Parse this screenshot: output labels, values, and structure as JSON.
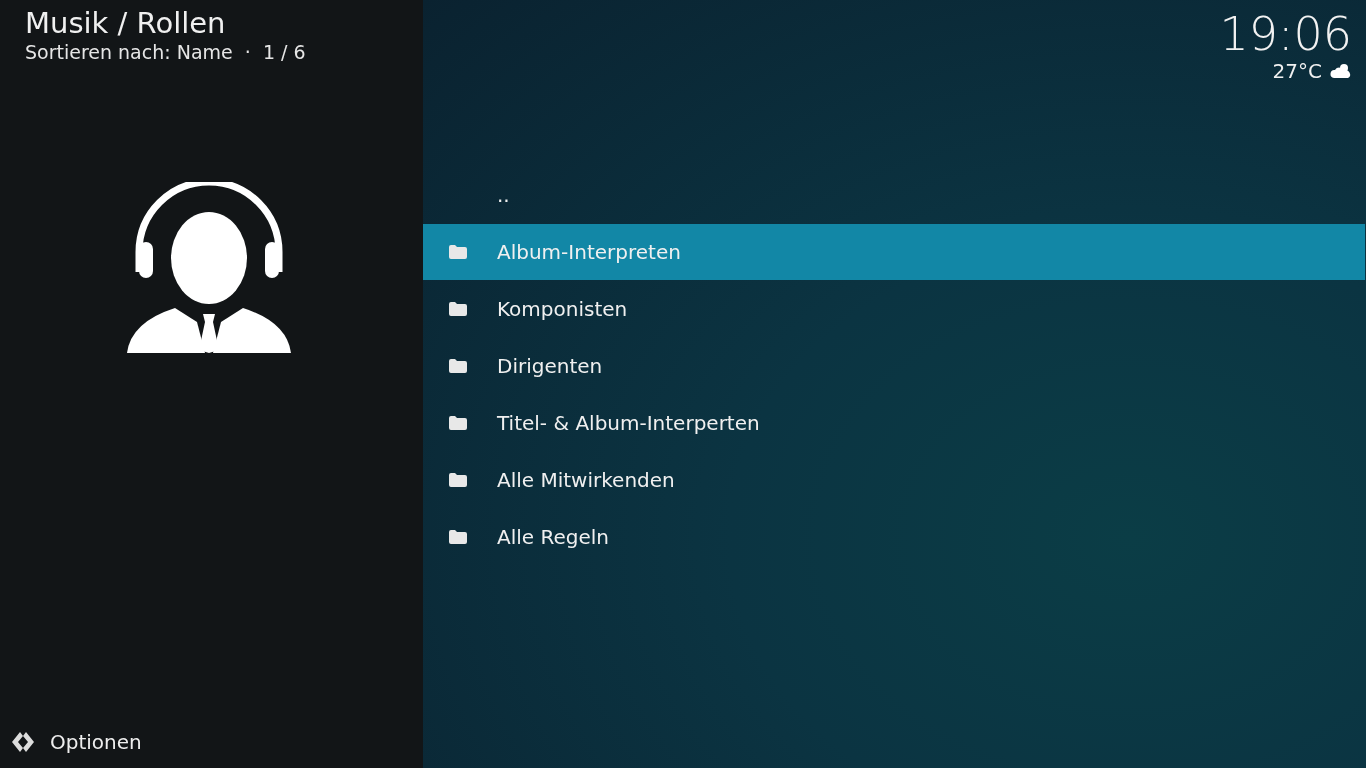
{
  "header": {
    "title": "Musik / Rollen",
    "subtitle": "Sortieren nach: Name  ·  1 / 6"
  },
  "clock": {
    "time": "19:06",
    "temperature": "27°C"
  },
  "list": [
    {
      "kind": "parent",
      "label": "..",
      "selected": false
    },
    {
      "kind": "folder",
      "label": "Album-Interpreten",
      "selected": true
    },
    {
      "kind": "folder",
      "label": "Komponisten",
      "selected": false
    },
    {
      "kind": "folder",
      "label": "Dirigenten",
      "selected": false
    },
    {
      "kind": "folder",
      "label": "Titel- & Album-Interperten",
      "selected": false
    },
    {
      "kind": "folder",
      "label": "Alle Mitwirkenden",
      "selected": false
    },
    {
      "kind": "folder",
      "label": "Alle Regeln",
      "selected": false
    }
  ],
  "options": {
    "label": "Optionen"
  }
}
